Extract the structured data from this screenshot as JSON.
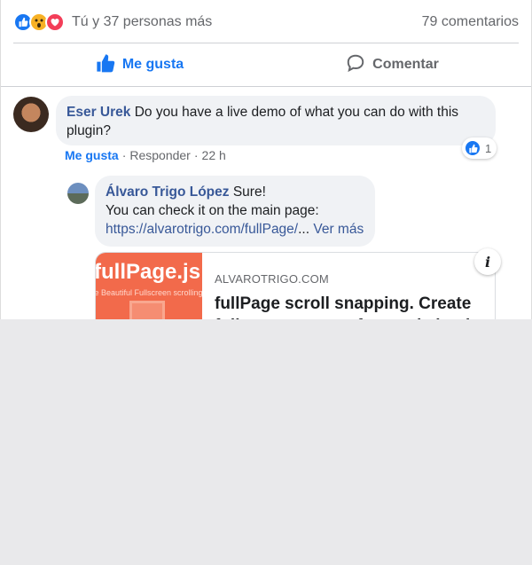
{
  "post_footer": {
    "reaction_summary": "Tú y 37 personas más",
    "reaction_icons": [
      "like-icon",
      "wow-icon",
      "love-icon"
    ],
    "comments_count": "79 comentarios",
    "like_label": "Me gusta",
    "comment_label": "Comentar"
  },
  "comments": [
    {
      "author": "Eser Urek",
      "text": "Do you have a live demo of what you can do with this plugin?",
      "reaction_count": "1",
      "like_label": "Me gusta",
      "reply_label": "Responder",
      "time": "22 h",
      "replies": [
        {
          "author": "Álvaro Trigo López",
          "text_line1": "Sure!",
          "text_line2": "You can check it on the main page:",
          "link": "https://alvarotrigo.com/fullPage/",
          "ellipsis": "...",
          "see_more": "Ver más",
          "preview": {
            "thumb_title": "fullPage.js",
            "thumb_subtitle": "te Beautiful Fullscreen scrolling web",
            "domain": "ALVAROTRIGO.COM",
            "title": "fullPage scroll snapping. Create full screen pages fast and simple"
          }
        }
      ]
    }
  ],
  "colors": {
    "accent": "#1877f2",
    "link": "#385898",
    "secondary_text": "#65676b",
    "bubble": "#f0f2f5",
    "thumb_bg": "#f26a4b"
  }
}
